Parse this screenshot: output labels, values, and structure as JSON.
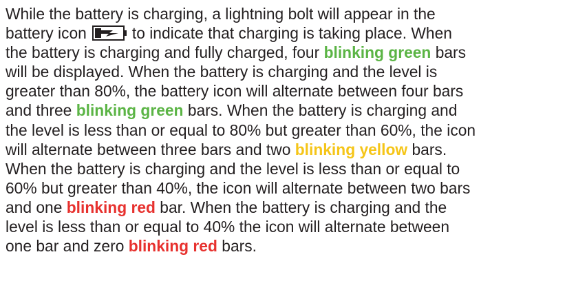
{
  "paragraph": {
    "l1_a": "While the battery is charging, a lightning bolt will appear in the",
    "l2_a": "battery icon",
    "l2_b": "to indicate that charging is taking place. When",
    "l3_a": "the battery is charging and fully charged, four",
    "l3_b": "blinking green",
    "l3_c": "bars",
    "l4_a": "will be displayed. When the battery is charging and the level is",
    "l5_a": "greater than 80%, the battery icon will alternate between four bars",
    "l6_a": "and three",
    "l6_b": "blinking green",
    "l6_c": "bars. When the battery is charging and",
    "l7_a": "the level is less than or equal to 80% but greater than 60%, the icon",
    "l8_a": "will alternate between three bars and two",
    "l8_b": "blinking yellow",
    "l8_c": "bars.",
    "l9_a": "When the battery is charging and the level is less than or equal to",
    "l10_a": "60% but greater than 40%, the icon will alternate between two bars",
    "l11_a": "and one",
    "l11_b": "blinking red",
    "l11_c": "bar. When the battery is charging and the",
    "l12_a": "level is less than or equal to 40% the icon will alternate between",
    "l13_a": "one bar and zero",
    "l13_b": "blinking red",
    "l13_c": "bars."
  },
  "colors": {
    "text": "#231f20",
    "green": "#5bb445",
    "yellow": "#f5c518",
    "red": "#e7312e"
  },
  "icons": {
    "inline_icon": "battery-charging-icon"
  }
}
